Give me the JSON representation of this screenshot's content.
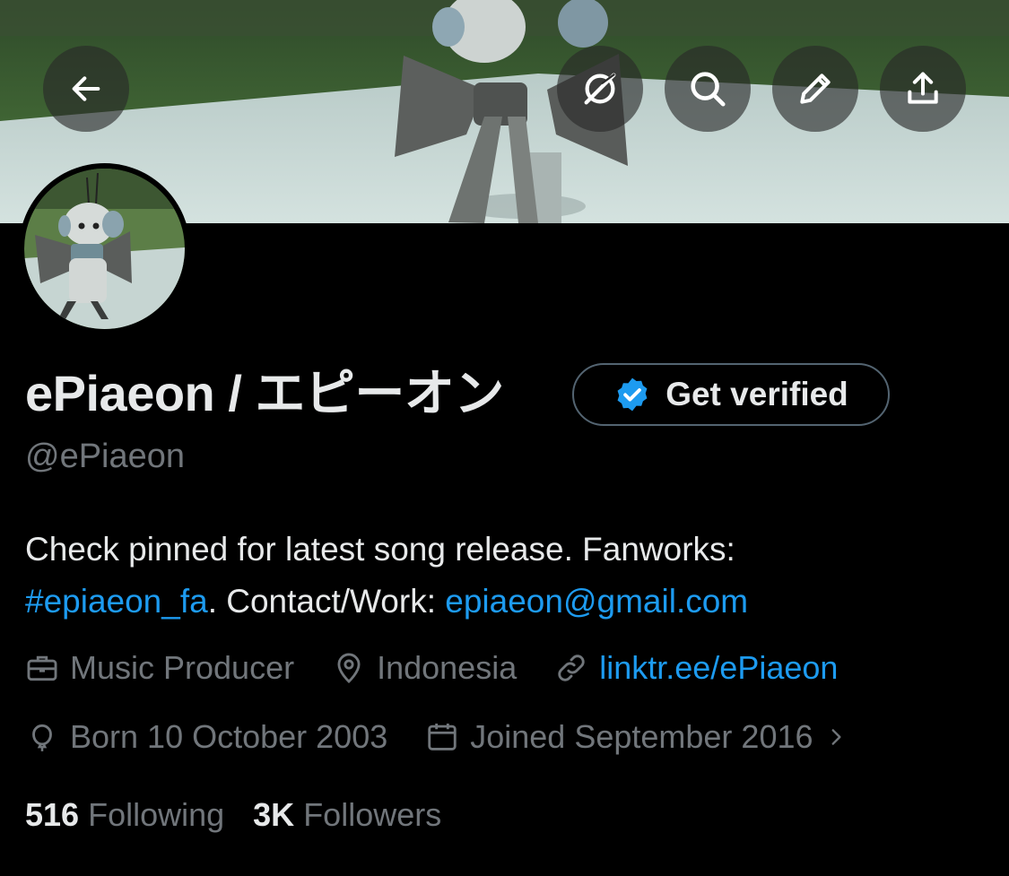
{
  "header": {
    "back_icon": "arrow-left-icon",
    "actions": [
      {
        "name": "mute-notifications",
        "icon": "slashed-circle-icon"
      },
      {
        "name": "search",
        "icon": "magnifier-icon"
      },
      {
        "name": "edit",
        "icon": "pencil-icon"
      },
      {
        "name": "share",
        "icon": "upload-icon"
      }
    ]
  },
  "profile": {
    "display_name": "ePiaeon / エピーオン",
    "handle": "@ePiaeon",
    "verify_button": {
      "label": "Get verified",
      "icon": "verified-badge-icon"
    }
  },
  "bio": {
    "text_1": "Check pinned for latest song release. Fanworks: ",
    "hashtag": "#epiaeon_fa",
    "text_2": ". Contact/Work: ",
    "email": "epiaeon@gmail.com"
  },
  "meta": {
    "profession": "Music Producer",
    "location": "Indonesia",
    "website": "linktr.ee/ePiaeon",
    "birthday": "Born 10 October 2003",
    "joined": "Joined September 2016"
  },
  "stats": {
    "following_count": "516",
    "following_label": "Following",
    "followers_count": "3K",
    "followers_label": "Followers"
  },
  "colors": {
    "background": "#000000",
    "primary_text": "#e7e9ea",
    "secondary_text": "#71767b",
    "link": "#1d9bf0",
    "border": "#536471"
  }
}
